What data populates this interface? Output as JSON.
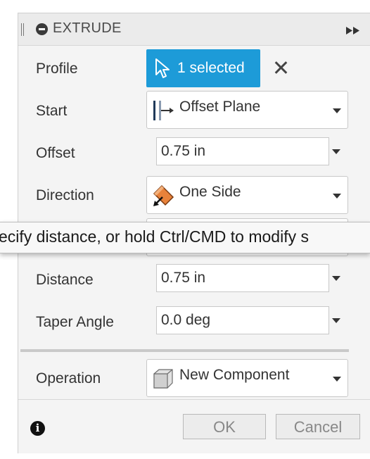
{
  "dialog": {
    "title": "EXTRUDE",
    "accent_color": "#1d9bd8"
  },
  "rows": {
    "profile": {
      "label": "Profile",
      "button_label": "1 selected"
    },
    "start": {
      "label": "Start",
      "value": "Offset Plane"
    },
    "offset": {
      "label": "Offset",
      "value": "0.75 in"
    },
    "direction": {
      "label": "Direction",
      "value": "One Side"
    },
    "distance": {
      "label": "Distance",
      "value": "0.75 in"
    },
    "taper": {
      "label": "Taper Angle",
      "value": "0.0 deg"
    },
    "operation": {
      "label": "Operation",
      "value": "New Component"
    }
  },
  "tooltip": {
    "text": "ecify distance, or hold Ctrl/CMD to modify s"
  },
  "footer": {
    "ok_label": "OK",
    "cancel_label": "Cancel"
  },
  "icons": {
    "collapse": "minus-circle-icon",
    "expand": "double-chevron-right-icon",
    "cursor": "arrow-cursor-icon",
    "clear": "close-icon",
    "offset_plane": "offset-plane-icon",
    "direction": "one-side-direction-icon",
    "operation": "new-component-cube-icon",
    "info": "info-icon"
  }
}
